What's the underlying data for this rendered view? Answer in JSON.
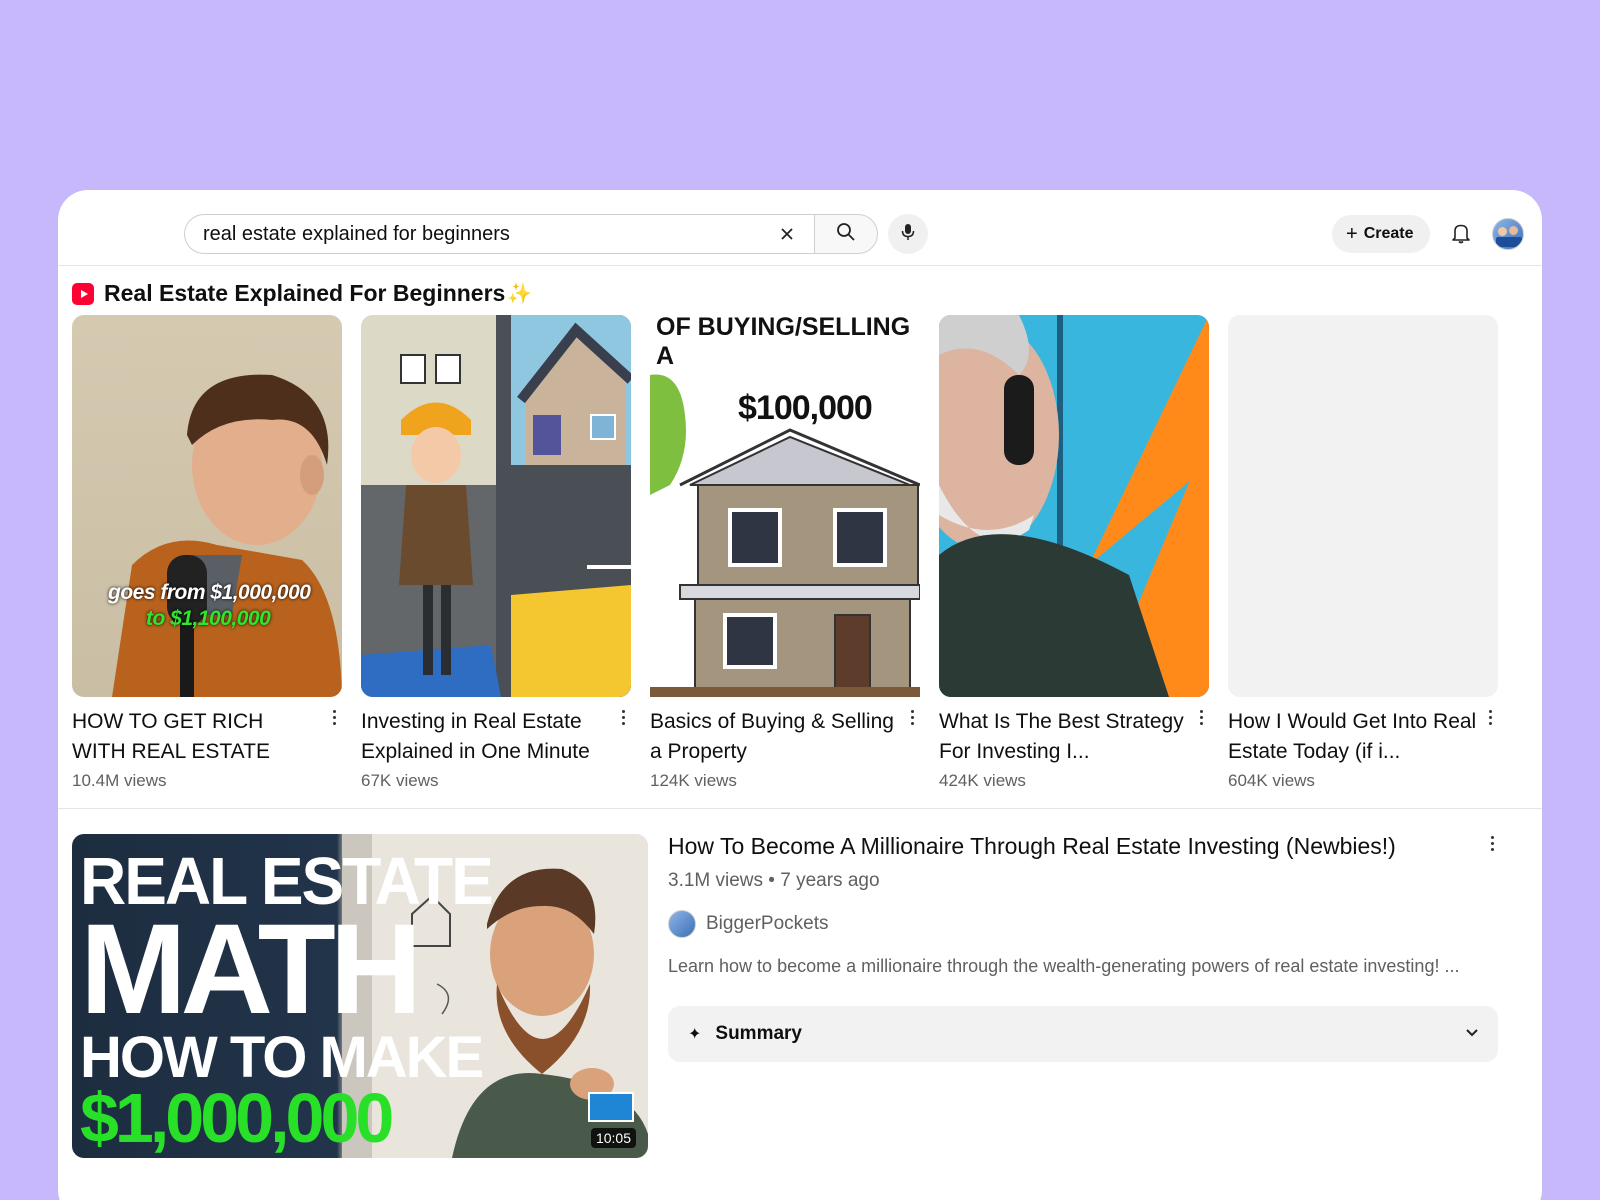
{
  "search": {
    "query": "real estate explained for beginners",
    "clear_icon": "close-icon",
    "search_icon": "search-icon",
    "mic_icon": "mic-icon"
  },
  "header": {
    "create_label": "Create",
    "bell_icon": "bell-icon"
  },
  "shelf": {
    "title": "Real Estate Explained For Beginners",
    "sparkle": "✨",
    "items": [
      {
        "title": "HOW TO GET RICH WITH REAL ESTATE",
        "views": "10.4M views",
        "overlay_line1": "goes from $1,000,000",
        "overlay_line2": "to $1,100,000"
      },
      {
        "title": "Investing in Real Estate Explained in One Minute",
        "views": "67K views"
      },
      {
        "title": "Basics of Buying & Selling a Property",
        "views": "124K views",
        "overlay_top": "OF BUYING/SELLING A",
        "overlay_price": "$100,000"
      },
      {
        "title": "What Is The Best Strategy For Investing I...",
        "views": "424K views"
      },
      {
        "title": "How I Would Get Into Real Estate Today (if i...",
        "views": "604K views"
      }
    ]
  },
  "video": {
    "title": "How To Become A Millionaire Through Real Estate Investing (Newbies!)",
    "meta": "3.1M views • 7 years ago",
    "channel": "BiggerPockets",
    "description": "Learn how to become a millionaire through the wealth-generating powers of real estate investing! ...",
    "duration": "10:05",
    "thumb_line1": "REAL ESTATE",
    "thumb_line2": "MATH",
    "thumb_line3": "HOW TO MAKE",
    "thumb_line4": "$1,000,000",
    "summary_label": "Summary"
  },
  "colors": {
    "background": "#c6b8fb",
    "brand_red": "#ff0033",
    "money_green": "#2ee62e"
  }
}
